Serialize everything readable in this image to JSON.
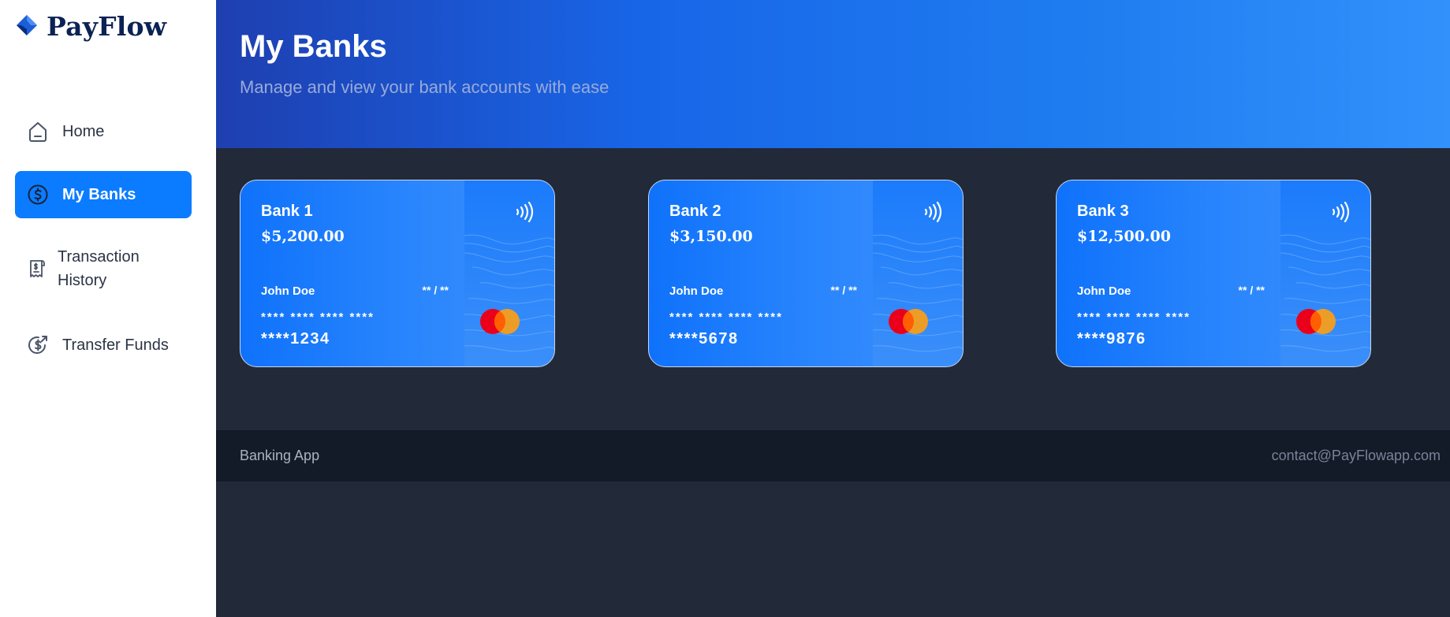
{
  "app": {
    "name": "PayFlow",
    "colors": {
      "brand": "#0b2254",
      "accent": "#0b7cff",
      "sidebar_bg": "#ffffff",
      "content_bg": "#222938",
      "footer_bg": "#131a28"
    }
  },
  "sidebar": {
    "items": [
      {
        "label": "Home",
        "icon": "home-icon",
        "active": false
      },
      {
        "label": "My Banks",
        "icon": "dollar-circle-icon",
        "active": true
      },
      {
        "label": "Transaction",
        "label2": "History",
        "icon": "receipt-icon",
        "active": false
      },
      {
        "label": "Transfer Funds",
        "icon": "dollar-send-icon",
        "active": false
      }
    ]
  },
  "header": {
    "title": "My Banks",
    "subtitle": "Manage and view your bank accounts with ease"
  },
  "cards": [
    {
      "bank": "Bank 1",
      "balance": "$5,200.00",
      "holder": "John Doe",
      "expiry": "** / **",
      "mask": "**** **** **** ****",
      "last": "****1234"
    },
    {
      "bank": "Bank 2",
      "balance": "$3,150.00",
      "holder": "John Doe",
      "expiry": "** / **",
      "mask": "**** **** **** ****",
      "last": "****5678"
    },
    {
      "bank": "Bank 3",
      "balance": "$12,500.00",
      "holder": "John Doe",
      "expiry": "** / **",
      "mask": "**** **** **** ****",
      "last": "****9876"
    }
  ],
  "footer": {
    "left": "Banking App",
    "right": "contact@PayFlowapp.com"
  }
}
